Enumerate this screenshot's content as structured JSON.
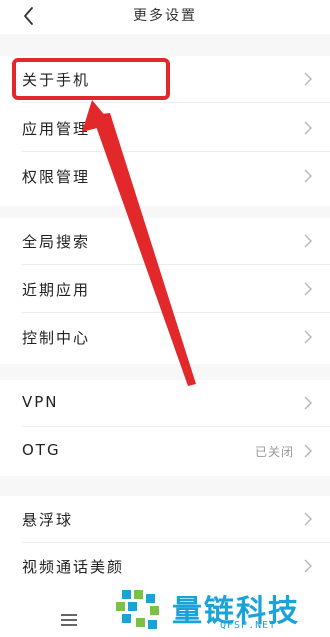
{
  "header": {
    "title": "更多设置"
  },
  "groups": [
    {
      "items": [
        {
          "label": "关于手机"
        },
        {
          "label": "应用管理"
        },
        {
          "label": "权限管理"
        }
      ]
    },
    {
      "items": [
        {
          "label": "全局搜索"
        },
        {
          "label": "近期应用"
        },
        {
          "label": "控制中心"
        }
      ]
    },
    {
      "items": [
        {
          "label": "VPN"
        },
        {
          "label": "OTG",
          "value": "已关闭"
        }
      ]
    },
    {
      "items": [
        {
          "label": "悬浮球"
        },
        {
          "label": "视频通话美颜"
        }
      ]
    }
  ],
  "watermark": {
    "text": "量链科技",
    "url": "QFSP.NET"
  },
  "colors": {
    "annotation": "#e3282b",
    "watermark": "#1aa3d8"
  }
}
